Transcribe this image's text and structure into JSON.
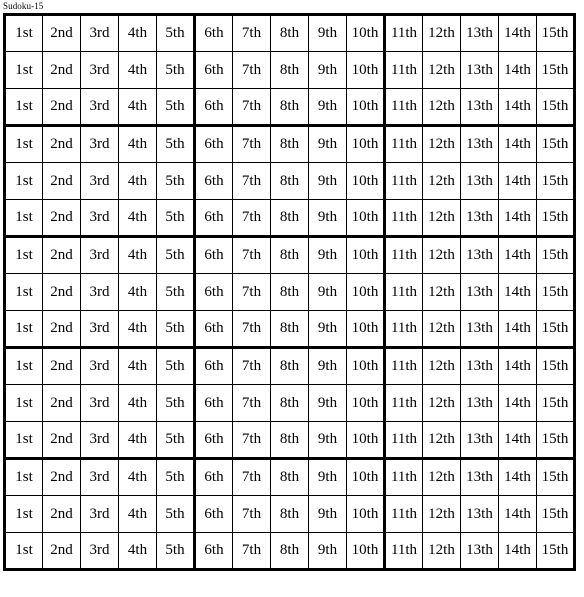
{
  "document": {
    "title": "Sudoku-15",
    "background_color": "#ffffff",
    "ink_color": "#000000"
  },
  "grid": {
    "name": "sudoku-15-grid",
    "rows": 15,
    "columns": 15,
    "block_columns": 5,
    "block_rows": 3,
    "thick_border_px": 3,
    "thin_border_px": 1,
    "thick_column_breaks": [
      5,
      10
    ],
    "thick_row_breaks": [
      3,
      6,
      9,
      12
    ],
    "column_labels": [
      "1st",
      "2nd",
      "3rd",
      "4th",
      "5th",
      "6th",
      "7th",
      "8th",
      "9th",
      "10th",
      "11th",
      "12th",
      "13th",
      "14th",
      "15th"
    ],
    "cells": [
      [
        "1st",
        "2nd",
        "3rd",
        "4th",
        "5th",
        "6th",
        "7th",
        "8th",
        "9th",
        "10th",
        "11th",
        "12th",
        "13th",
        "14th",
        "15th"
      ],
      [
        "1st",
        "2nd",
        "3rd",
        "4th",
        "5th",
        "6th",
        "7th",
        "8th",
        "9th",
        "10th",
        "11th",
        "12th",
        "13th",
        "14th",
        "15th"
      ],
      [
        "1st",
        "2nd",
        "3rd",
        "4th",
        "5th",
        "6th",
        "7th",
        "8th",
        "9th",
        "10th",
        "11th",
        "12th",
        "13th",
        "14th",
        "15th"
      ],
      [
        "1st",
        "2nd",
        "3rd",
        "4th",
        "5th",
        "6th",
        "7th",
        "8th",
        "9th",
        "10th",
        "11th",
        "12th",
        "13th",
        "14th",
        "15th"
      ],
      [
        "1st",
        "2nd",
        "3rd",
        "4th",
        "5th",
        "6th",
        "7th",
        "8th",
        "9th",
        "10th",
        "11th",
        "12th",
        "13th",
        "14th",
        "15th"
      ],
      [
        "1st",
        "2nd",
        "3rd",
        "4th",
        "5th",
        "6th",
        "7th",
        "8th",
        "9th",
        "10th",
        "11th",
        "12th",
        "13th",
        "14th",
        "15th"
      ],
      [
        "1st",
        "2nd",
        "3rd",
        "4th",
        "5th",
        "6th",
        "7th",
        "8th",
        "9th",
        "10th",
        "11th",
        "12th",
        "13th",
        "14th",
        "15th"
      ],
      [
        "1st",
        "2nd",
        "3rd",
        "4th",
        "5th",
        "6th",
        "7th",
        "8th",
        "9th",
        "10th",
        "11th",
        "12th",
        "13th",
        "14th",
        "15th"
      ],
      [
        "1st",
        "2nd",
        "3rd",
        "4th",
        "5th",
        "6th",
        "7th",
        "8th",
        "9th",
        "10th",
        "11th",
        "12th",
        "13th",
        "14th",
        "15th"
      ],
      [
        "1st",
        "2nd",
        "3rd",
        "4th",
        "5th",
        "6th",
        "7th",
        "8th",
        "9th",
        "10th",
        "11th",
        "12th",
        "13th",
        "14th",
        "15th"
      ],
      [
        "1st",
        "2nd",
        "3rd",
        "4th",
        "5th",
        "6th",
        "7th",
        "8th",
        "9th",
        "10th",
        "11th",
        "12th",
        "13th",
        "14th",
        "15th"
      ],
      [
        "1st",
        "2nd",
        "3rd",
        "4th",
        "5th",
        "6th",
        "7th",
        "8th",
        "9th",
        "10th",
        "11th",
        "12th",
        "13th",
        "14th",
        "15th"
      ],
      [
        "1st",
        "2nd",
        "3rd",
        "4th",
        "5th",
        "6th",
        "7th",
        "8th",
        "9th",
        "10th",
        "11th",
        "12th",
        "13th",
        "14th",
        "15th"
      ],
      [
        "1st",
        "2nd",
        "3rd",
        "4th",
        "5th",
        "6th",
        "7th",
        "8th",
        "9th",
        "10th",
        "11th",
        "12th",
        "13th",
        "14th",
        "15th"
      ],
      [
        "1st",
        "2nd",
        "3rd",
        "4th",
        "5th",
        "6th",
        "7th",
        "8th",
        "9th",
        "10th",
        "11th",
        "12th",
        "13th",
        "14th",
        "15th"
      ]
    ]
  }
}
